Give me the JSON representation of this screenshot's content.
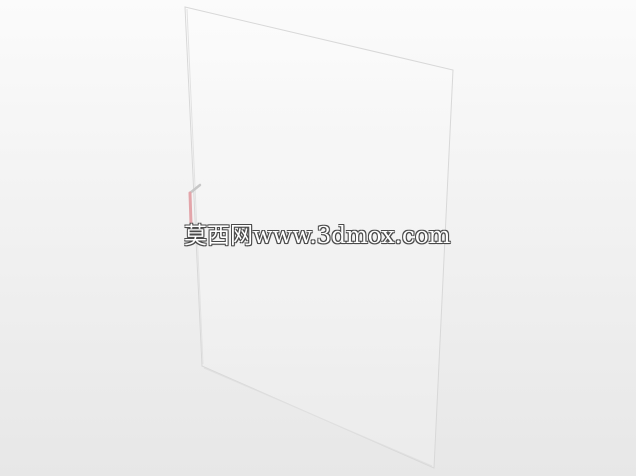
{
  "scene": {
    "subject": "glass-door-panel",
    "background_color": "#f0f0f0",
    "panel_edge_color": "#d6d6d6",
    "handle_color": "#e6a3a8"
  },
  "watermark": {
    "text": "莫西网www.3dmox.com"
  }
}
